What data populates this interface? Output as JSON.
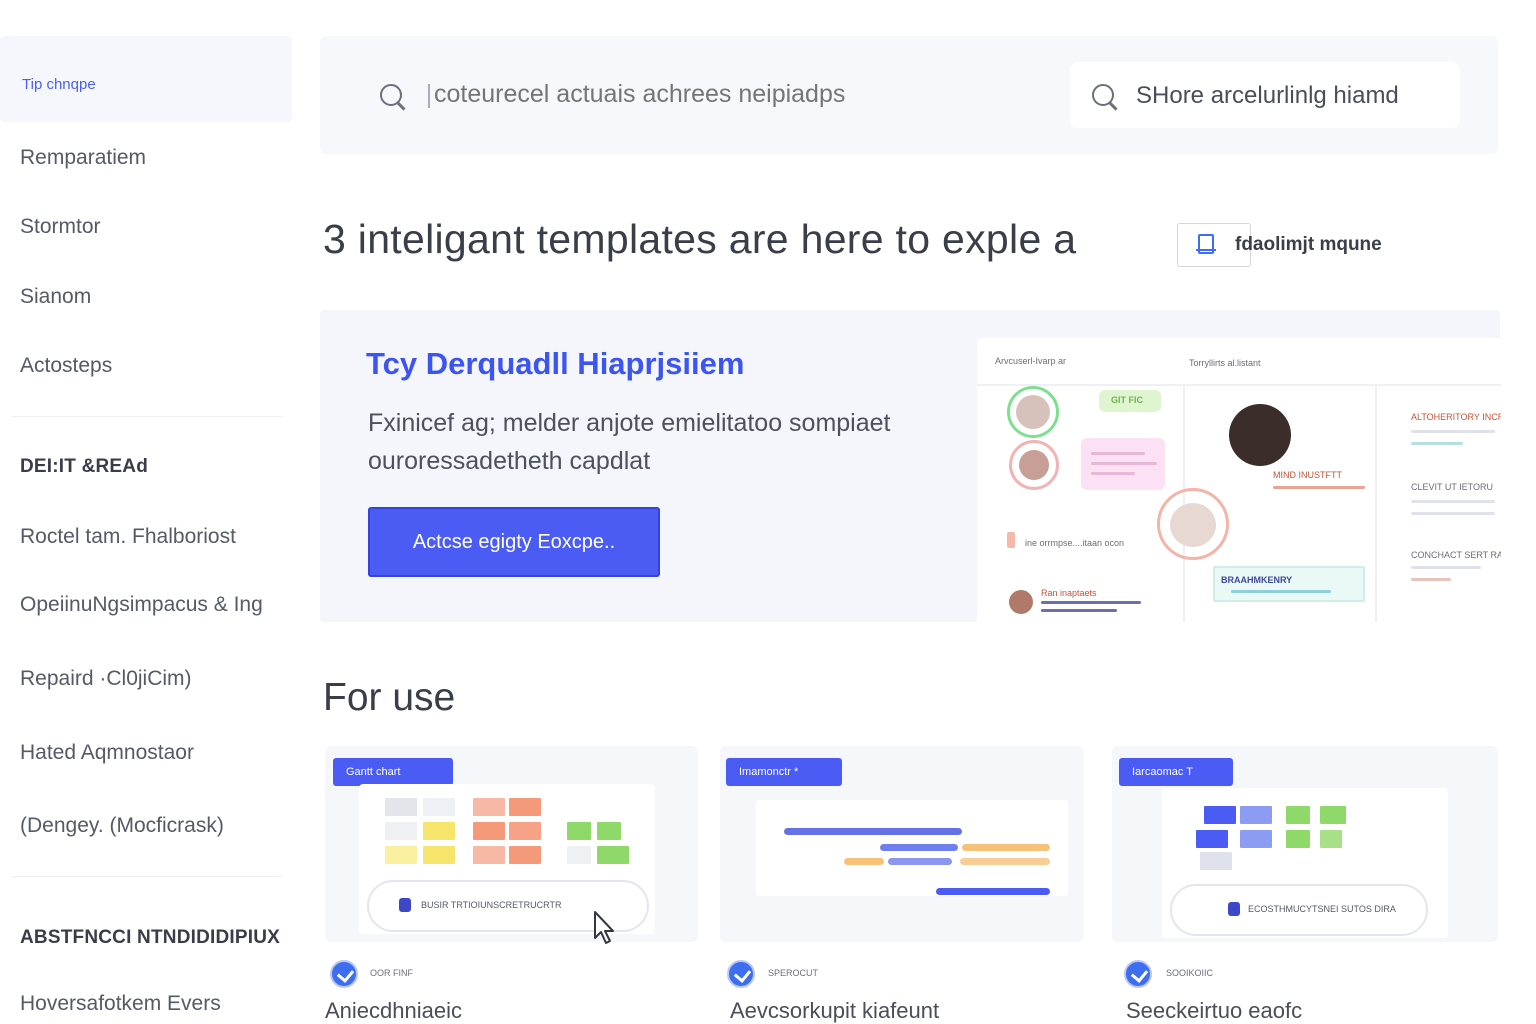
{
  "sidebar": {
    "active": "Tip chnqpe",
    "items": [
      "Remparatiem",
      "Stormtor",
      "Sianom",
      "Actosteps"
    ],
    "section1": {
      "heading": "DEI:IT &REAd",
      "items": [
        "Roctel tam. Fhalboriost",
        "OpeiinuNgsimpacus & Ing",
        "Repaird ·Cl0jiCim)",
        "Hated Aqmnostaor",
        "(Dengey. (Mocficrask)"
      ]
    },
    "section2": {
      "heading": "ABSTFNCCI NTNDIDIDIPIUX",
      "items": [
        "Hoversafotkem Evers"
      ]
    }
  },
  "search": {
    "placeholder": "coteurecel actuais achrees neipiadps",
    "secondary": "SHore arcelurlinlg hiamd"
  },
  "headline": "3 inteligant templates are here to exple a",
  "headline_pill": "fdaolimjt mqune",
  "hero": {
    "title": "Tcy Derquadll Hiaprjsiiem",
    "description": "Fxinicef ag; melder anjote emielitatoo sompiaet ouroressadetheth capdlat",
    "button": "Actcse egigty Eoxcpe..",
    "preview": {
      "header_left": "Arvcuserl-Ivarp ar",
      "header_right": "Torryllirts al.listant",
      "tag": "GIT FIC",
      "chat_line": "ine orrmpse....itaan ocon",
      "caption": "MIND INUSTFTT",
      "right_col": [
        "ALTOHERITORY INCRITY",
        "CLEVIT UT IETORU",
        "CONCHACT SERT RATO"
      ],
      "footer_name": "Ran inaptaets",
      "panel_caption": "BRAAHMKENRY"
    }
  },
  "section": {
    "title": "For use",
    "cards": [
      {
        "tag": "Gantt chart",
        "pill_text": "BUSIR TRTIOIUNSCRETRUCRTR",
        "meta": "OOR FINF",
        "title": "Aniecdhniaeic"
      },
      {
        "tag": "Imamonctr *",
        "meta": "SPEROCUT",
        "title": "Aevcsorkupit kiafeunt"
      },
      {
        "tag": "Iarcaomac T",
        "pill_text": "ECOSTHMUCYTSNEI SUTOS DIRA",
        "meta": "SOOIKOIIC",
        "title": "Seeckeirtuo eaofc"
      }
    ]
  },
  "colors": {
    "accent": "#4a5cf4",
    "accent_text": "#3c55f2",
    "salmon": "#f49a7a",
    "yellow": "#f7e56b",
    "green": "#8fd86a"
  }
}
